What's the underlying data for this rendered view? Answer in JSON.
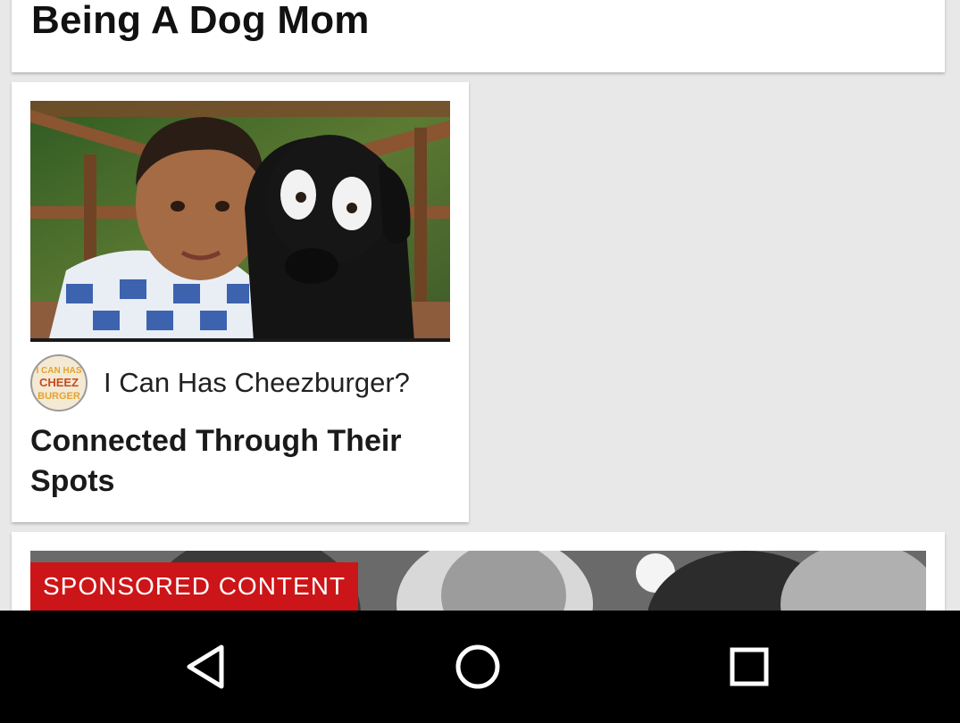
{
  "feed": {
    "top_card": {
      "title": "Being A Dog Mom"
    },
    "article_card": {
      "image_icon": "boy-and-dog-photo",
      "source_logo_icon": "cheezburger-logo-icon",
      "source_logo_text": [
        "I CAN HAS",
        "CHEEZ",
        "BURGER"
      ],
      "source_name": "I Can Has Cheezburger?",
      "headline": "Connected Through Their Spots"
    },
    "sponsored_card": {
      "badge": "SPONSORED CONTENT",
      "image_icon": "grayscale-crowd-photo"
    }
  },
  "navbar": {
    "back_icon": "back-triangle-icon",
    "home_icon": "home-circle-icon",
    "recents_icon": "recents-square-icon"
  },
  "colors": {
    "background": "#e8e8e8",
    "card": "#ffffff",
    "sponsored_badge": "#cc1518",
    "navbar": "#000000"
  }
}
